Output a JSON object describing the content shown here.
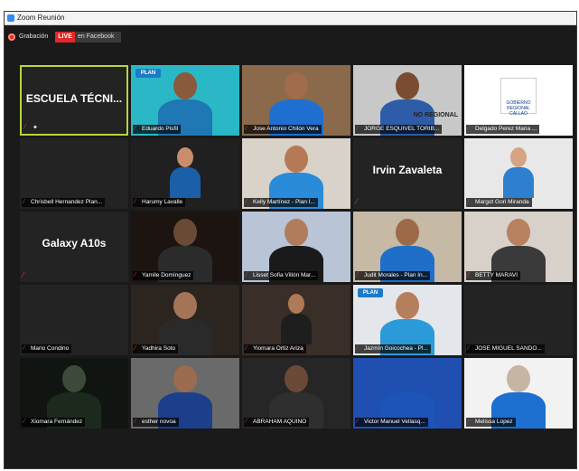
{
  "window": {
    "title": "Zoom Reunión"
  },
  "recording": {
    "label": "Grabación",
    "live": "LIVE",
    "live_target": "en Facebook"
  },
  "tiles": [
    {
      "name": "",
      "center_text": "ESCUELA TÉCNI...",
      "active": true,
      "kind": "text"
    },
    {
      "name": "Eduardo Pisfil",
      "kind": "video",
      "bg": "#2ab8c7",
      "skin": "#8b5a3c",
      "shirt": "#1f77b4",
      "logo": "PLAN"
    },
    {
      "name": "Jose Antonio Chilón Vera",
      "kind": "video",
      "bg": "#8a6a4a",
      "skin": "#a06c4b",
      "shirt": "#1f6fd1"
    },
    {
      "name": "JORGE ESQUIVEL TORIB...",
      "kind": "video",
      "bg": "#c8c8c8",
      "skin": "#7a4c32",
      "shirt": "#2e5ca8",
      "banner": "NO REGIONAL"
    },
    {
      "name": "Delgado Perez Maria ...",
      "kind": "logo",
      "bg": "#ffffff",
      "logo_text": "GOBIERNO REGIONAL CALLAO"
    },
    {
      "name": "Chrisbell Hernandez Plan...",
      "kind": "blank"
    },
    {
      "name": "Harumy Lavalle",
      "kind": "video",
      "bg": "#202020",
      "skin": "#c98d6b",
      "shirt": "#1b5fa8",
      "small": true
    },
    {
      "name": "Kelly Martínez - Plan I...",
      "kind": "video",
      "bg": "#d9d2c8",
      "skin": "#b57a55",
      "shirt": "#2a8bd8"
    },
    {
      "name": "",
      "center_text": "Irvin Zavaleta",
      "kind": "text"
    },
    {
      "name": "Margot Gori Miranda",
      "kind": "video",
      "bg": "#e8e8e8",
      "skin": "#d6a384",
      "shirt": "#2f7fd0",
      "small": true
    },
    {
      "name": "",
      "center_text": "Galaxy A10s",
      "kind": "text"
    },
    {
      "name": "Yamile Domínguez",
      "kind": "video",
      "bg": "#1c1410",
      "skin": "#6b4a35",
      "shirt": "#2b2b2b"
    },
    {
      "name": "Lisset Sofia Villón Mar...",
      "kind": "video",
      "bg": "#b9c4d6",
      "skin": "#b07c5c",
      "shirt": "#1a1a1a"
    },
    {
      "name": "Judit Morales - Plan In...",
      "kind": "video",
      "bg": "#c6b9a6",
      "skin": "#9d6a48",
      "shirt": "#1f6fc8"
    },
    {
      "name": "BETTY MARAVI",
      "kind": "video",
      "bg": "#d7d1c9",
      "skin": "#b88160",
      "shirt": "#3a3a3a"
    },
    {
      "name": "Mario Condino",
      "kind": "blank"
    },
    {
      "name": "Yadhira Soto",
      "kind": "video",
      "bg": "#2b241f",
      "skin": "#a37458",
      "shirt": "#2a2a2a"
    },
    {
      "name": "Yiomara Ortiz Ariza",
      "kind": "video",
      "bg": "#3a2e28",
      "skin": "#b07a56",
      "shirt": "#1e1e1e",
      "small": true
    },
    {
      "name": "Jazmín Goicochea - Pl...",
      "kind": "video",
      "bg": "#e3e6ea",
      "skin": "#b57f5d",
      "shirt": "#2a9bd8",
      "logo": "PLAN"
    },
    {
      "name": "JOSE MIGUEL SANDO...",
      "kind": "blank"
    },
    {
      "name": "Xiomara Fernández",
      "kind": "video",
      "bg": "#101512",
      "skin": "#3c4a3a",
      "shirt": "#1b2a1c"
    },
    {
      "name": "esther novoa",
      "kind": "video",
      "bg": "#6a6a6a",
      "skin": "#9b6c4f",
      "shirt": "#1b3f8b"
    },
    {
      "name": "ABRAHAM AQUINO",
      "kind": "video",
      "bg": "#262626",
      "skin": "#6a4a36",
      "shirt": "#2f2f2f"
    },
    {
      "name": "Victor Manuel Vellasq...",
      "kind": "video",
      "bg": "#1f4fb0",
      "skin": "#1f4fb0",
      "shirt": "#1d54b8"
    },
    {
      "name": "Melissa Lopez",
      "kind": "video",
      "bg": "#f2f2f2",
      "skin": "#c7b5a3",
      "shirt": "#1d6fd0"
    }
  ],
  "icons": {
    "mic_muted": "mic-muted-icon",
    "pin": "pin-icon",
    "record": "record-icon"
  }
}
